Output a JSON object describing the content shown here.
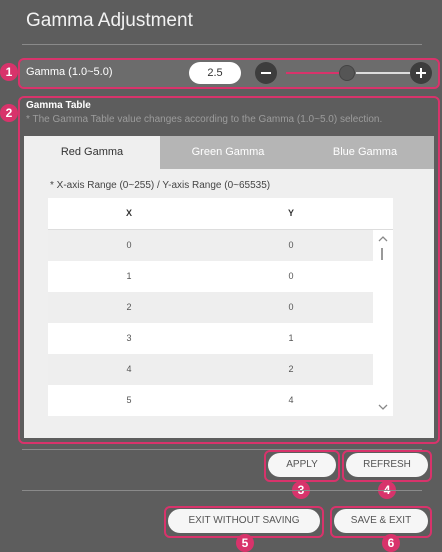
{
  "title": "Gamma Adjustment",
  "gamma": {
    "label": "Gamma (1.0~5.0)",
    "value": "2.5",
    "min": 1.0,
    "max": 5.0,
    "slider_fraction": 0.375
  },
  "gamma_table": {
    "title": "Gamma Table",
    "note": "* The Gamma Table value changes according to the Gamma (1.0~5.0) selection.",
    "tabs": [
      {
        "label": "Red Gamma",
        "active": true
      },
      {
        "label": "Green Gamma",
        "active": false
      },
      {
        "label": "Blue Gamma",
        "active": false
      }
    ],
    "range_note": "* X-axis Range (0~255) / Y-axis Range (0~65535)",
    "columns": [
      "X",
      "Y"
    ],
    "rows": [
      {
        "x": "0",
        "y": "0"
      },
      {
        "x": "1",
        "y": "0"
      },
      {
        "x": "2",
        "y": "0"
      },
      {
        "x": "3",
        "y": "1"
      },
      {
        "x": "4",
        "y": "2"
      },
      {
        "x": "5",
        "y": "4"
      }
    ]
  },
  "buttons": {
    "apply": "APPLY",
    "refresh": "REFRESH",
    "exit_without_saving": "EXIT WITHOUT SAVING",
    "save_exit": "SAVE & EXIT"
  },
  "callouts": [
    "1",
    "2",
    "3",
    "4",
    "5",
    "6"
  ],
  "colors": {
    "accent": "#d8336b",
    "background": "#5d5d5d",
    "panel": "#efefef"
  }
}
